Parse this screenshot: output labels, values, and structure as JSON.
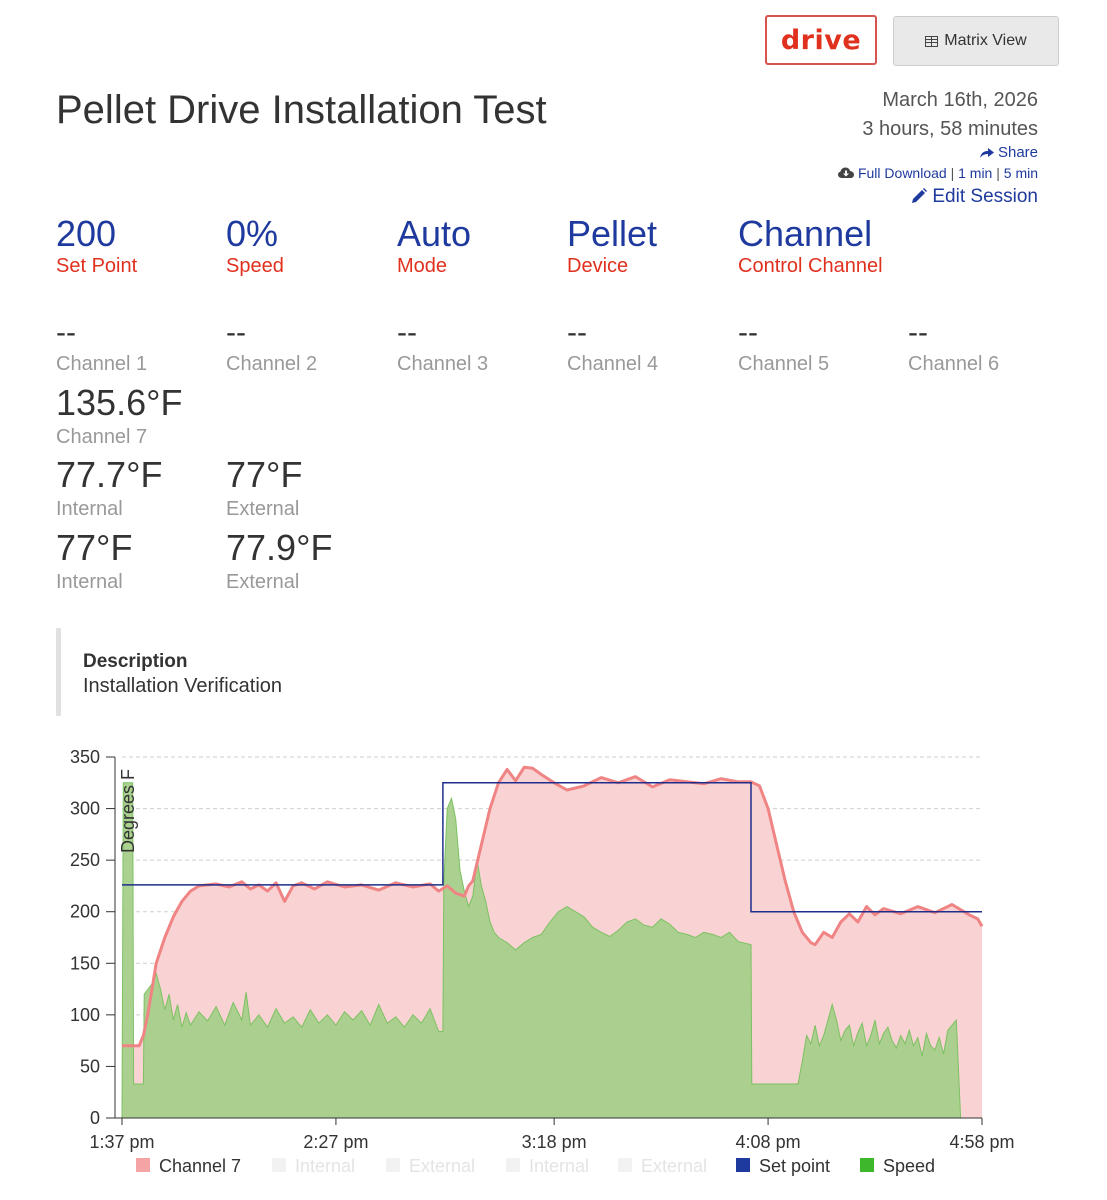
{
  "header": {
    "logo_text": "drive",
    "matrix_button_label": "Matrix View",
    "matrix_icon": "table-grid-icon"
  },
  "session": {
    "title": "Pellet Drive Installation Test",
    "date": "March 16th, 2026",
    "duration": "3 hours, 58 minutes",
    "share_label": "Share",
    "download_full": "Full Download",
    "download_1min": "1 min",
    "download_5min": "5 min",
    "edit_label": "Edit Session"
  },
  "stats": [
    {
      "value": "200",
      "label": "Set Point"
    },
    {
      "value": "0%",
      "label": "Speed"
    },
    {
      "value": "Auto",
      "label": "Mode"
    },
    {
      "value": "Pellet",
      "label": "Device"
    },
    {
      "value": "Channel",
      "label": "Control Channel"
    }
  ],
  "channels": [
    {
      "value": "--",
      "label": "Channel 1"
    },
    {
      "value": "--",
      "label": "Channel 2"
    },
    {
      "value": "--",
      "label": "Channel 3"
    },
    {
      "value": "--",
      "label": "Channel 4"
    },
    {
      "value": "--",
      "label": "Channel 5"
    },
    {
      "value": "--",
      "label": "Channel 6"
    }
  ],
  "channel7": {
    "value": "135.6°F",
    "label": "Channel 7"
  },
  "readings": [
    {
      "value": "77.7°F",
      "label": "Internal"
    },
    {
      "value": "77°F",
      "label": "External"
    },
    {
      "value": "77°F",
      "label": "Internal"
    },
    {
      "value": "77.9°F",
      "label": "External"
    }
  ],
  "description": {
    "heading": "Description",
    "text": "Installation Verification"
  },
  "colors": {
    "accent_blue": "#1f3a9e",
    "accent_red": "#e0301e",
    "channel7_fill": "#f9d3d3",
    "channel7_line": "#f08484",
    "speed_fill": "#a6cf8a",
    "speed_line": "#7cc162",
    "setpoint_line": "#1f2e8c"
  },
  "chart_data": {
    "type": "area",
    "ylabel": "Degrees F",
    "ylim": [
      0,
      350
    ],
    "yticks": [
      0,
      50,
      100,
      150,
      200,
      250,
      300,
      350
    ],
    "xlim_minutes": [
      0,
      201
    ],
    "xticks": [
      {
        "label": "1:37 pm",
        "minute": 0
      },
      {
        "label": "2:27 pm",
        "minute": 50
      },
      {
        "label": "3:18 pm",
        "minute": 101
      },
      {
        "label": "4:08 pm",
        "minute": 151
      },
      {
        "label": "4:58 pm",
        "minute": 201
      }
    ],
    "grid": true,
    "legend": [
      {
        "name": "Channel 7",
        "color": "#f4a4a4",
        "active": true
      },
      {
        "name": "Internal",
        "color": "#f2f2f2",
        "active": false
      },
      {
        "name": "External",
        "color": "#f2f2f2",
        "active": false
      },
      {
        "name": "Internal",
        "color": "#f2f2f2",
        "active": false
      },
      {
        "name": "External",
        "color": "#f2f2f2",
        "active": false
      },
      {
        "name": "Set point",
        "color": "#1f3a9e",
        "active": true
      },
      {
        "name": "Speed",
        "color": "#3cb82a",
        "active": true
      }
    ],
    "series": [
      {
        "name": "Channel 7",
        "points": [
          [
            0,
            70
          ],
          [
            4,
            70
          ],
          [
            5,
            80
          ],
          [
            6,
            100
          ],
          [
            7,
            125
          ],
          [
            8,
            150
          ],
          [
            10,
            175
          ],
          [
            12,
            195
          ],
          [
            14,
            210
          ],
          [
            16,
            220
          ],
          [
            18,
            225
          ],
          [
            22,
            227
          ],
          [
            25,
            224
          ],
          [
            28,
            229
          ],
          [
            30,
            222
          ],
          [
            32,
            226
          ],
          [
            34,
            220
          ],
          [
            36,
            228
          ],
          [
            38,
            210
          ],
          [
            40,
            225
          ],
          [
            42,
            228
          ],
          [
            45,
            222
          ],
          [
            48,
            229
          ],
          [
            52,
            224
          ],
          [
            56,
            226
          ],
          [
            60,
            221
          ],
          [
            64,
            228
          ],
          [
            68,
            224
          ],
          [
            72,
            227
          ],
          [
            74,
            220
          ],
          [
            76,
            225
          ],
          [
            78,
            218
          ],
          [
            80,
            215
          ],
          [
            81,
            225
          ],
          [
            82,
            230
          ],
          [
            84,
            265
          ],
          [
            86,
            300
          ],
          [
            88,
            325
          ],
          [
            90,
            338
          ],
          [
            92,
            327
          ],
          [
            94,
            340
          ],
          [
            96,
            339
          ],
          [
            98,
            333
          ],
          [
            101,
            325
          ],
          [
            104,
            318
          ],
          [
            108,
            322
          ],
          [
            112,
            330
          ],
          [
            116,
            325
          ],
          [
            120,
            331
          ],
          [
            124,
            321
          ],
          [
            128,
            328
          ],
          [
            132,
            326
          ],
          [
            136,
            324
          ],
          [
            140,
            329
          ],
          [
            144,
            326
          ],
          [
            147,
            326
          ],
          [
            149,
            322
          ],
          [
            151,
            300
          ],
          [
            153,
            265
          ],
          [
            155,
            230
          ],
          [
            157,
            200
          ],
          [
            159,
            180
          ],
          [
            161,
            170
          ],
          [
            162,
            168
          ],
          [
            164,
            180
          ],
          [
            166,
            175
          ],
          [
            168,
            190
          ],
          [
            170,
            198
          ],
          [
            172,
            190
          ],
          [
            174,
            205
          ],
          [
            176,
            197
          ],
          [
            178,
            203
          ],
          [
            182,
            198
          ],
          [
            186,
            205
          ],
          [
            190,
            199
          ],
          [
            194,
            207
          ],
          [
            198,
            197
          ],
          [
            200,
            193
          ],
          [
            201,
            186
          ]
        ]
      },
      {
        "name": "Speed",
        "points": [
          [
            0,
            0
          ],
          [
            0.3,
            325
          ],
          [
            2.5,
            325
          ],
          [
            2.7,
            33
          ],
          [
            5,
            33
          ],
          [
            5.2,
            120
          ],
          [
            7,
            130
          ],
          [
            8,
            140
          ],
          [
            9,
            125
          ],
          [
            10,
            105
          ],
          [
            11,
            120
          ],
          [
            12,
            95
          ],
          [
            13,
            110
          ],
          [
            14,
            88
          ],
          [
            15,
            102
          ],
          [
            16,
            90
          ],
          [
            18,
            103
          ],
          [
            20,
            94
          ],
          [
            22,
            108
          ],
          [
            24,
            90
          ],
          [
            26,
            112
          ],
          [
            28,
            95
          ],
          [
            29,
            122
          ],
          [
            30,
            90
          ],
          [
            32,
            100
          ],
          [
            34,
            88
          ],
          [
            36,
            106
          ],
          [
            38,
            92
          ],
          [
            40,
            98
          ],
          [
            42,
            88
          ],
          [
            44,
            105
          ],
          [
            46,
            92
          ],
          [
            48,
            100
          ],
          [
            50,
            90
          ],
          [
            52,
            103
          ],
          [
            54,
            95
          ],
          [
            56,
            104
          ],
          [
            58,
            90
          ],
          [
            60,
            110
          ],
          [
            62,
            92
          ],
          [
            64,
            98
          ],
          [
            66,
            88
          ],
          [
            68,
            100
          ],
          [
            70,
            92
          ],
          [
            72,
            106
          ],
          [
            73,
            95
          ],
          [
            74,
            84
          ],
          [
            75,
            84
          ],
          [
            75.2,
            228
          ],
          [
            76,
            300
          ],
          [
            77,
            310
          ],
          [
            78,
            290
          ],
          [
            79,
            240
          ],
          [
            80,
            220
          ],
          [
            81,
            205
          ],
          [
            82,
            215
          ],
          [
            83,
            250
          ],
          [
            84,
            225
          ],
          [
            85,
            210
          ],
          [
            86,
            190
          ],
          [
            87,
            180
          ],
          [
            88,
            175
          ],
          [
            90,
            170
          ],
          [
            92,
            163
          ],
          [
            94,
            170
          ],
          [
            96,
            175
          ],
          [
            98,
            178
          ],
          [
            100,
            190
          ],
          [
            102,
            200
          ],
          [
            104,
            205
          ],
          [
            106,
            200
          ],
          [
            108,
            195
          ],
          [
            110,
            185
          ],
          [
            112,
            180
          ],
          [
            114,
            176
          ],
          [
            116,
            182
          ],
          [
            118,
            190
          ],
          [
            120,
            193
          ],
          [
            122,
            187
          ],
          [
            124,
            185
          ],
          [
            126,
            193
          ],
          [
            128,
            188
          ],
          [
            130,
            180
          ],
          [
            132,
            178
          ],
          [
            134,
            175
          ],
          [
            136,
            180
          ],
          [
            138,
            178
          ],
          [
            140,
            175
          ],
          [
            142,
            180
          ],
          [
            144,
            171
          ],
          [
            147,
            168
          ],
          [
            147.2,
            33
          ],
          [
            152,
            33
          ],
          [
            158,
            33
          ],
          [
            159,
            55
          ],
          [
            160,
            80
          ],
          [
            161,
            72
          ],
          [
            162,
            90
          ],
          [
            163,
            70
          ],
          [
            164,
            80
          ],
          [
            165,
            95
          ],
          [
            166,
            110
          ],
          [
            167,
            95
          ],
          [
            168,
            75
          ],
          [
            169,
            85
          ],
          [
            170,
            90
          ],
          [
            171,
            70
          ],
          [
            172,
            83
          ],
          [
            173,
            92
          ],
          [
            174,
            70
          ],
          [
            175,
            80
          ],
          [
            176,
            95
          ],
          [
            177,
            72
          ],
          [
            178,
            82
          ],
          [
            179,
            88
          ],
          [
            180,
            75
          ],
          [
            181,
            68
          ],
          [
            182,
            80
          ],
          [
            183,
            72
          ],
          [
            184,
            85
          ],
          [
            185,
            70
          ],
          [
            186,
            78
          ],
          [
            187,
            60
          ],
          [
            188,
            82
          ],
          [
            189,
            70
          ],
          [
            190,
            66
          ],
          [
            191,
            78
          ],
          [
            192,
            62
          ],
          [
            193,
            85
          ],
          [
            195,
            95
          ],
          [
            196,
            0
          ]
        ]
      },
      {
        "name": "Set point",
        "points": [
          [
            0,
            226
          ],
          [
            75,
            226
          ],
          [
            75,
            325
          ],
          [
            147,
            325
          ],
          [
            147,
            200
          ],
          [
            201,
            200
          ]
        ]
      }
    ]
  }
}
